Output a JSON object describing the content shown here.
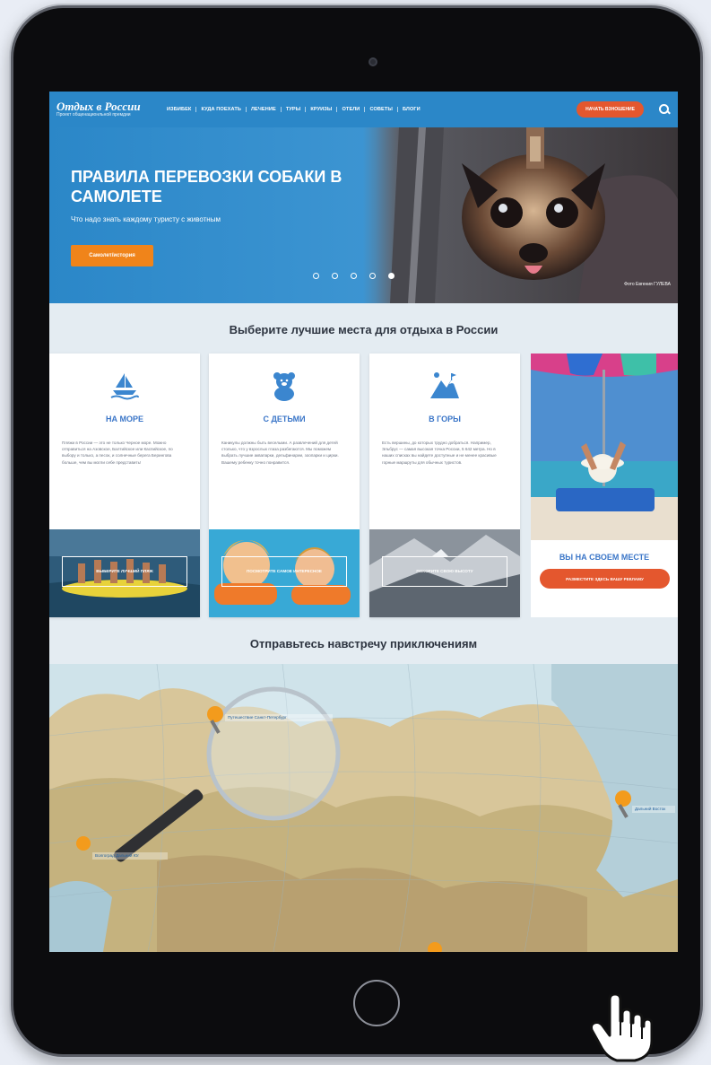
{
  "header": {
    "logo_title": "Отдых в России",
    "logo_subtitle": "Проект общенационльной премдии",
    "nav": [
      "ИЗБИБЕК",
      "КУДА ПОЕХАТЬ",
      "ЛЕЧЕНИЕ",
      "ТУРЫ",
      "КРУИЗЫ",
      "ОТЕЛИ",
      "СОВЕТЫ",
      "БЛОГИ"
    ],
    "cta_label": "НАЧАТЬ ВЗНОШЕНИЕ",
    "search_icon": "search-icon"
  },
  "hero": {
    "title": "ПРАВИЛА ПЕРЕВОЗКИ СОБАКИ В САМОЛЕТЕ",
    "subtitle": "Что надо знать каждому туристу с животным",
    "button_label": "Самолет/история",
    "photo_credit": "Фото Евгения ГУЛЕВА",
    "slides_total": 5,
    "active_slide": 5
  },
  "sections": {
    "best_places_title": "Выберите лучшие места для отдыха в России",
    "adventure_title": "Отправьтесь навстречу приключениям"
  },
  "cards": [
    {
      "icon": "sea-icon",
      "title": "НА МОРЕ",
      "text": "Пляжи в России — это не только Черное море. Можно отправиться на Азовское, Балтийское или Каспийское, по выбору и только, а песок, и солнечные берега Берингова больше, чем вы могли себе представить!",
      "photo_button": "ВЫБЕРИТЕ ЛУЧШИЙ ПЛЯЖ"
    },
    {
      "icon": "teddy-bear-icon",
      "title": "С ДЕТЬМИ",
      "text": "Каникулы должны быть веселыми. А развлечений для детей столько, что у взрослых глаза разбегаются. Мы поможем выбрать лучшие аквапарки, дельфинарии, зоопарки и цирки. Вашему ребенку точно понравится.",
      "photo_button": "ПОСМОТРИТЕ САМОЕ ИНТЕРЕСНОЕ"
    },
    {
      "icon": "mountain-icon",
      "title": "В ГОРЫ",
      "text": "Есть вершины, до которых трудно добраться. Например, Эльбрус — самая высокая точка России, 5 642 метра. Но в наших списках вы найдете доступные и не менее красивые горные маршруты для обычных туристов.",
      "photo_button": "ПОКОРИТЕ СВОЮ ВЫСОТУ"
    }
  ],
  "ad": {
    "title": "ВЫ НА СВОЕМ МЕСТЕ",
    "button_label": "РАЗМЕСТИТЕ ЗДЕСЬ ВАШУ РЕКЛАМУ"
  },
  "map": {
    "labels": [
      "Путешествие Санкт-Петербург",
      "Дальний Восток",
      "Волгоград Дальний Юг"
    ]
  },
  "colors": {
    "brand_blue": "#2b87c8",
    "accent_orange": "#f0841a",
    "accent_red": "#e4572e",
    "title_blue": "#3b76c8"
  }
}
